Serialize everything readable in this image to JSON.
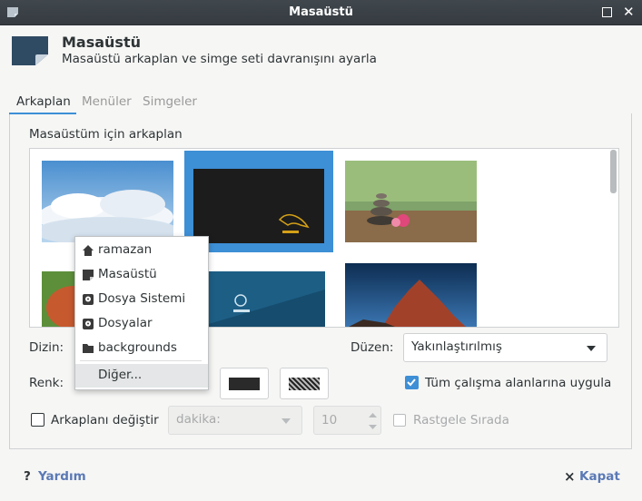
{
  "window": {
    "title": "Masaüstü"
  },
  "header": {
    "title": "Masaüstü",
    "subtitle": "Masaüstü arkaplan ve simge seti davranışını ayarla"
  },
  "tabs": [
    {
      "label": "Arkaplan",
      "active": true
    },
    {
      "label": "Menüler",
      "active": false
    },
    {
      "label": "Simgeler",
      "active": false
    }
  ],
  "background": {
    "section_label": "Masaüstüm için arkaplan",
    "dizin_label": "Dizin:",
    "duzen_label": "Düzen:",
    "duzen_value": "Yakınlaştırılmış",
    "renk_label": "Renk:",
    "apply_all_label": "Tüm çalışma alanlarına uygula",
    "change_label": "Arkaplanı değiştir",
    "interval_placeholder": "dakika:",
    "interval_value": "10",
    "random_label": "Rastgele Sırada"
  },
  "folder_menu": {
    "items": [
      {
        "label": "ramazan",
        "icon": "home-icon"
      },
      {
        "label": "Masaüstü",
        "icon": "desktop-folder-icon"
      },
      {
        "label": "Dosya Sistemi",
        "icon": "drive-icon"
      },
      {
        "label": "Dosyalar",
        "icon": "drive-icon"
      },
      {
        "label": "backgrounds",
        "icon": "folder-icon"
      }
    ],
    "other_label": "Diğer..."
  },
  "footer": {
    "help_label": "Yardım",
    "close_label": "Kapat",
    "help_glyph": "?",
    "close_glyph": "×"
  },
  "colors": {
    "accent": "#3d8fd6",
    "primary_color_swatch": "#2a2a2a"
  }
}
